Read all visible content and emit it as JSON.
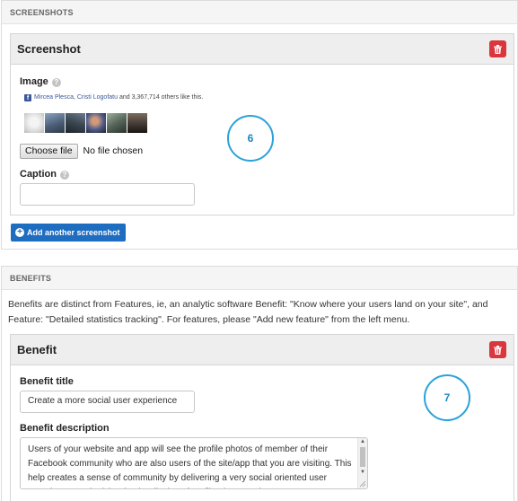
{
  "screenshots": {
    "section_title": "SCREENSHOTS",
    "panel_title": "Screenshot",
    "image_label": "Image",
    "help_glyph": "?",
    "fb_widget": {
      "logo_letter": "f",
      "name1": "Mircea Plesca",
      "separator": ", ",
      "name2": "Cristi Logofatu",
      "rest": " and 3,367,714 others like this."
    },
    "file_button": "Choose file",
    "file_status": "No file chosen",
    "caption_label": "Caption",
    "caption_value": "",
    "add_button": "Add another screenshot",
    "add_icon": "+",
    "marker": "6"
  },
  "benefits": {
    "section_title": "BENEFITS",
    "description": "Benefits are distinct from Features, ie, an analytic software Benefit: \"Know where your users land on your site\", and Feature: \"Detailed statistics tracking\". For features, please \"Add new feature\" from the left menu.",
    "panel_title": "Benefit",
    "title_label": "Benefit title",
    "title_value": "Create a more social user experience",
    "desc_label": "Benefit description",
    "desc_value": "Users of your website and app will see the profile photos of member of their Facebook community who are also users of the site/app that you are visiting. This help creates a sense of community by delivering a very social oriented user experience made richer by the display of profile photographs.",
    "marker": "7"
  },
  "icons": {
    "delete": "trash-icon",
    "add": "plus-circle-icon",
    "help": "help-icon",
    "facebook": "facebook-icon"
  },
  "colors": {
    "delete_button": "#d9363e",
    "primary_button": "#1f6dc0",
    "marker_ring": "#2aa2d9",
    "facebook_blue": "#3b5998"
  }
}
